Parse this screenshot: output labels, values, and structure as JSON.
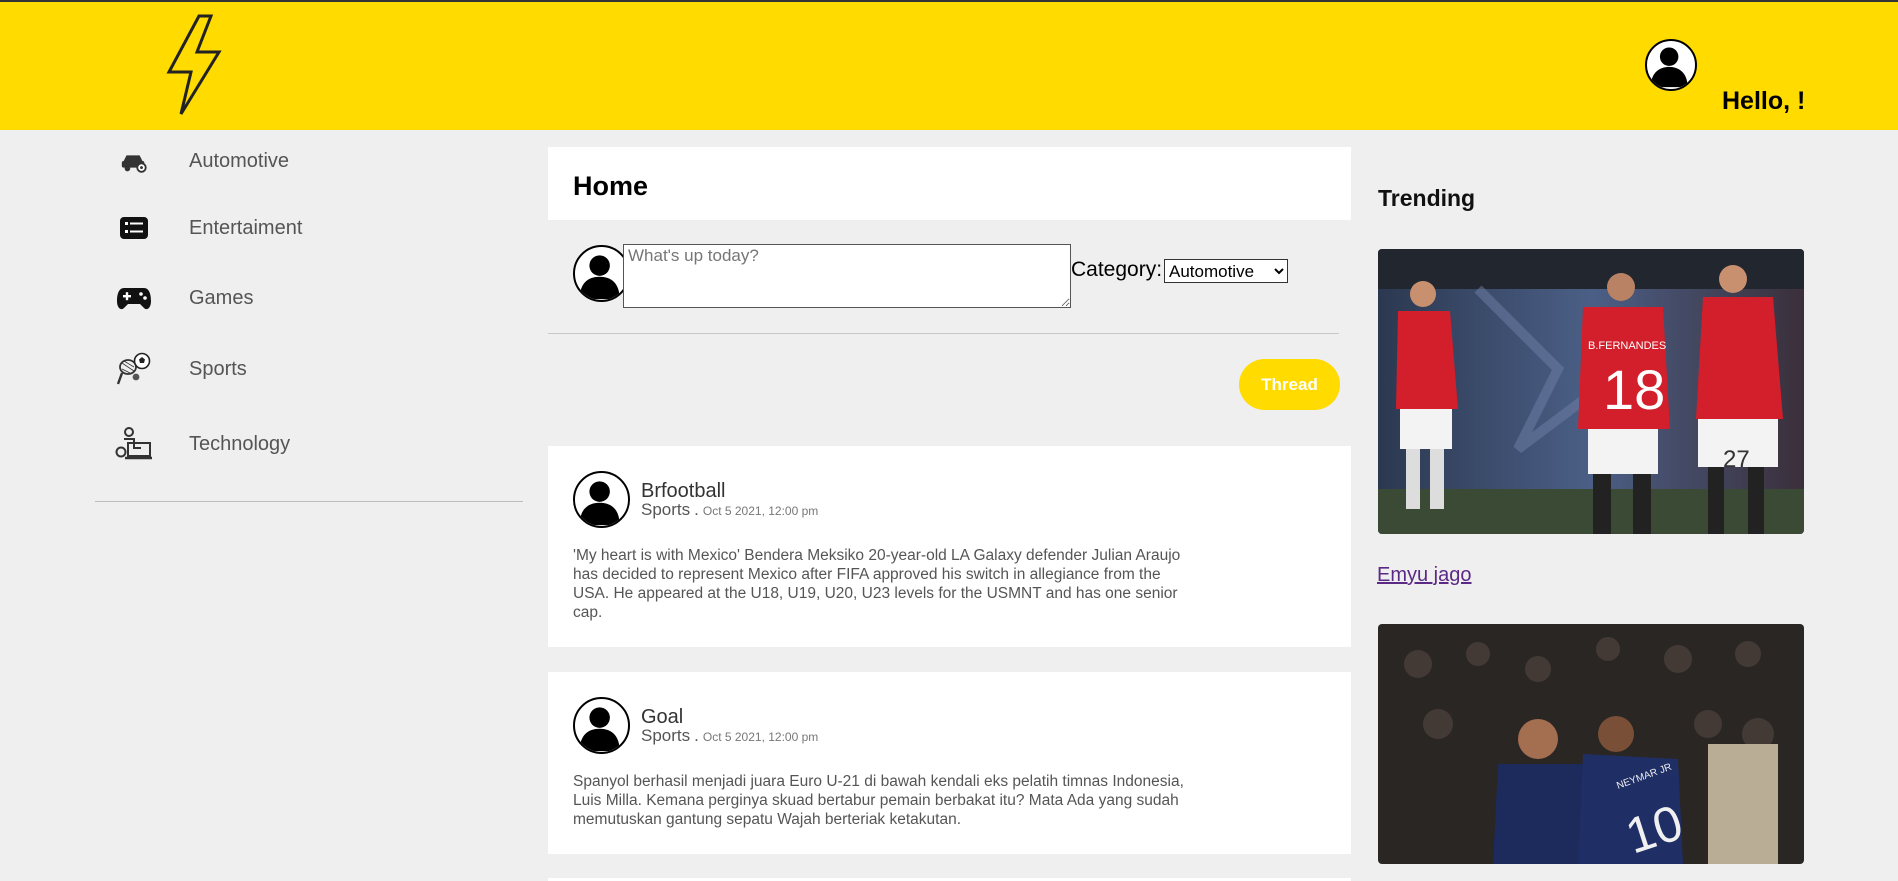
{
  "header": {
    "greeting": "Hello, !",
    "brand_color": "#ffdb00"
  },
  "sidebar": {
    "items": [
      {
        "label": "Automotive",
        "icon": "car-icon"
      },
      {
        "label": "Entertaiment",
        "icon": "list-icon"
      },
      {
        "label": "Games",
        "icon": "gamepad-icon"
      },
      {
        "label": "Sports",
        "icon": "sports-icon"
      },
      {
        "label": "Technology",
        "icon": "computer-user-icon"
      }
    ]
  },
  "main": {
    "title": "Home",
    "composer": {
      "placeholder": "What's up today?",
      "category_label": "Category:",
      "category_selected": "Automotive",
      "submit_label": "Thread"
    },
    "posts": [
      {
        "author": "Brfootball",
        "category": "Sports",
        "separator": ".",
        "date": "Oct 5 2021, 12:00 pm",
        "body": "'My heart is with Mexico' Bendera Meksiko 20-year-old LA Galaxy defender Julian Araujo has decided to represent Mexico after FIFA approved his switch in allegiance from the USA. He appeared at the U18, U19, U20, U23 levels for the USMNT and has one senior cap."
      },
      {
        "author": "Goal",
        "category": "Sports",
        "separator": ".",
        "date": "Oct 5 2021, 12:00 pm",
        "body": "Spanyol berhasil menjadi juara Euro U-21 di bawah kendali eks pelatih timnas Indonesia, Luis Milla. Kemana perginya skuad bertabur pemain berbakat itu? Mata Ada yang sudah memutuskan gantung sepatu Wajah berteriak ketakutan."
      }
    ]
  },
  "trending": {
    "title": "Trending",
    "items": [
      {
        "link": "Emyu jago",
        "jersey_numbers": [
          "18",
          "27"
        ],
        "jersey_name": "B.FERNANDES"
      },
      {
        "jersey_numbers": [
          "10"
        ],
        "jersey_name": "NEYMAR JR"
      }
    ]
  }
}
